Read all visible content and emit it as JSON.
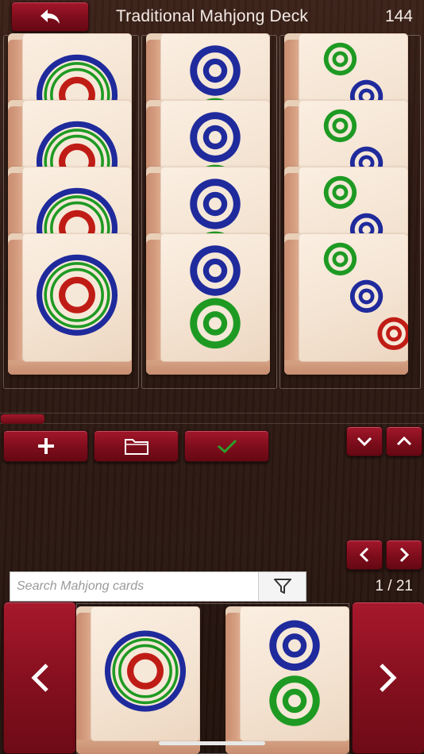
{
  "header": {
    "back_icon": "undo-arrow-icon",
    "title": "Traditional Mahjong Deck",
    "count": "144"
  },
  "columns": [
    {
      "tile": "one-circle",
      "quantity": 4
    },
    {
      "tile": "two-circles",
      "quantity": 4
    },
    {
      "tile": "three-circles",
      "quantity": 4
    }
  ],
  "toolbar": {
    "add_icon": "plus-icon",
    "open_icon": "folder-icon",
    "confirm_icon": "checkmark-icon",
    "collapse_icon": "chevron-down-icon",
    "expand_icon": "chevron-up-icon"
  },
  "browser": {
    "prev_icon": "chevron-left-icon",
    "next_icon": "chevron-right-icon",
    "search_placeholder": "Search Mahjong cards",
    "search_value": "",
    "filter_icon": "filter-icon",
    "page_indicator": "1 / 21",
    "visible_tiles": [
      "one-circle",
      "two-circles"
    ]
  },
  "colors": {
    "accent_red": "#8f1222",
    "circle_blue": "#1f2a9c",
    "circle_green": "#1e9a23",
    "circle_red": "#c01c16",
    "tile_face": "#f5e6d6"
  }
}
